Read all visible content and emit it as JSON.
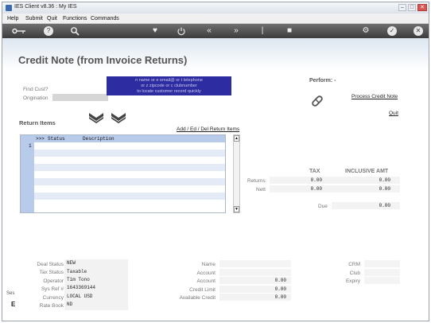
{
  "window": {
    "title": "IES Client v8.36 : My IES"
  },
  "menu": [
    "Help",
    "Submit",
    "Quit",
    "Functions",
    "Commands"
  ],
  "toolbar": {
    "icons": [
      "key-icon",
      "help-icon",
      "search-icon",
      "heart-icon",
      "power-icon",
      "rewind-icon",
      "fast-forward-icon",
      "pipe-icon",
      "stop-icon",
      "settings-icon",
      "check-icon",
      "close-icon"
    ]
  },
  "page": {
    "title": "Credit Note (from Invoice Returns)",
    "find_cust_label": "Find Cust?",
    "origination_label": "Origination",
    "hint": [
      "n name or e email@ or t telephone",
      "or z zipcode or c clubnumber",
      "to locate customer record quickly"
    ],
    "perform_label": "Perform: -",
    "process_link": "Process Credit Note",
    "quit_link": "Quit",
    "return_items_title": "Return Items",
    "add_ed_del_link": "Add / Ed / Del Return Items"
  },
  "grid": {
    "col_marker": ">>>",
    "col_status": "Status",
    "col_description": "Description",
    "row_number": "1"
  },
  "totals": {
    "tax_header": "TAX",
    "incl_header": "INCLUSIVE AMT",
    "returns_label": "Returns",
    "nett_label": "Nett",
    "due_label": "Due",
    "returns_tax": "0.00",
    "returns_incl": "0.00",
    "nett_tax": "0.00",
    "nett_incl": "0.00",
    "due_value": "0.00"
  },
  "deal": {
    "labels": [
      "Deal Status",
      "Tax Status",
      "Operator",
      "Sys Ref #",
      "Currency",
      "Rate Book"
    ],
    "values": [
      "NEW",
      "Taxable",
      "Tim Tono",
      "1643369144",
      "LOCAL USD",
      "ND"
    ]
  },
  "account": {
    "labels": [
      "Name",
      "Account",
      "Account",
      "Credit Limit",
      "Available Credit"
    ],
    "account2_value": "0.00",
    "credit_limit_value": "0.00",
    "available_credit_value": "0.00"
  },
  "crm": {
    "labels": [
      "CRM",
      "Club",
      "Expiry"
    ]
  },
  "side": {
    "label1": "Ses",
    "label2": "E"
  }
}
